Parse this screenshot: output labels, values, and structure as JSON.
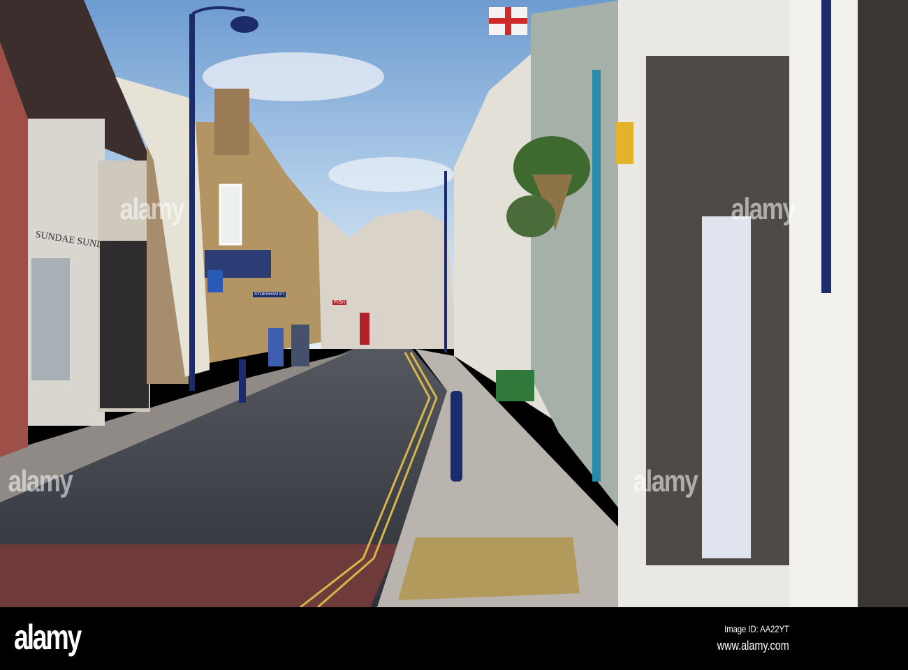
{
  "photo": {
    "description_icon": "street-photo",
    "signs": {
      "shop_left": "SUNDAE SUNDAE",
      "street_name": "SYDENHAM ST",
      "fish_shop": "FISH"
    },
    "colors": {
      "sky": "#9fc3e6",
      "road": "#3a3d44",
      "pavement": "#b8b3ab",
      "navy": "#1c2b6b",
      "teal": "#2b8aa6"
    }
  },
  "watermark": {
    "text": "alamy"
  },
  "footer": {
    "logo": "alamy",
    "image_id": "Image ID: AA22YT",
    "website": "www.alamy.com"
  }
}
